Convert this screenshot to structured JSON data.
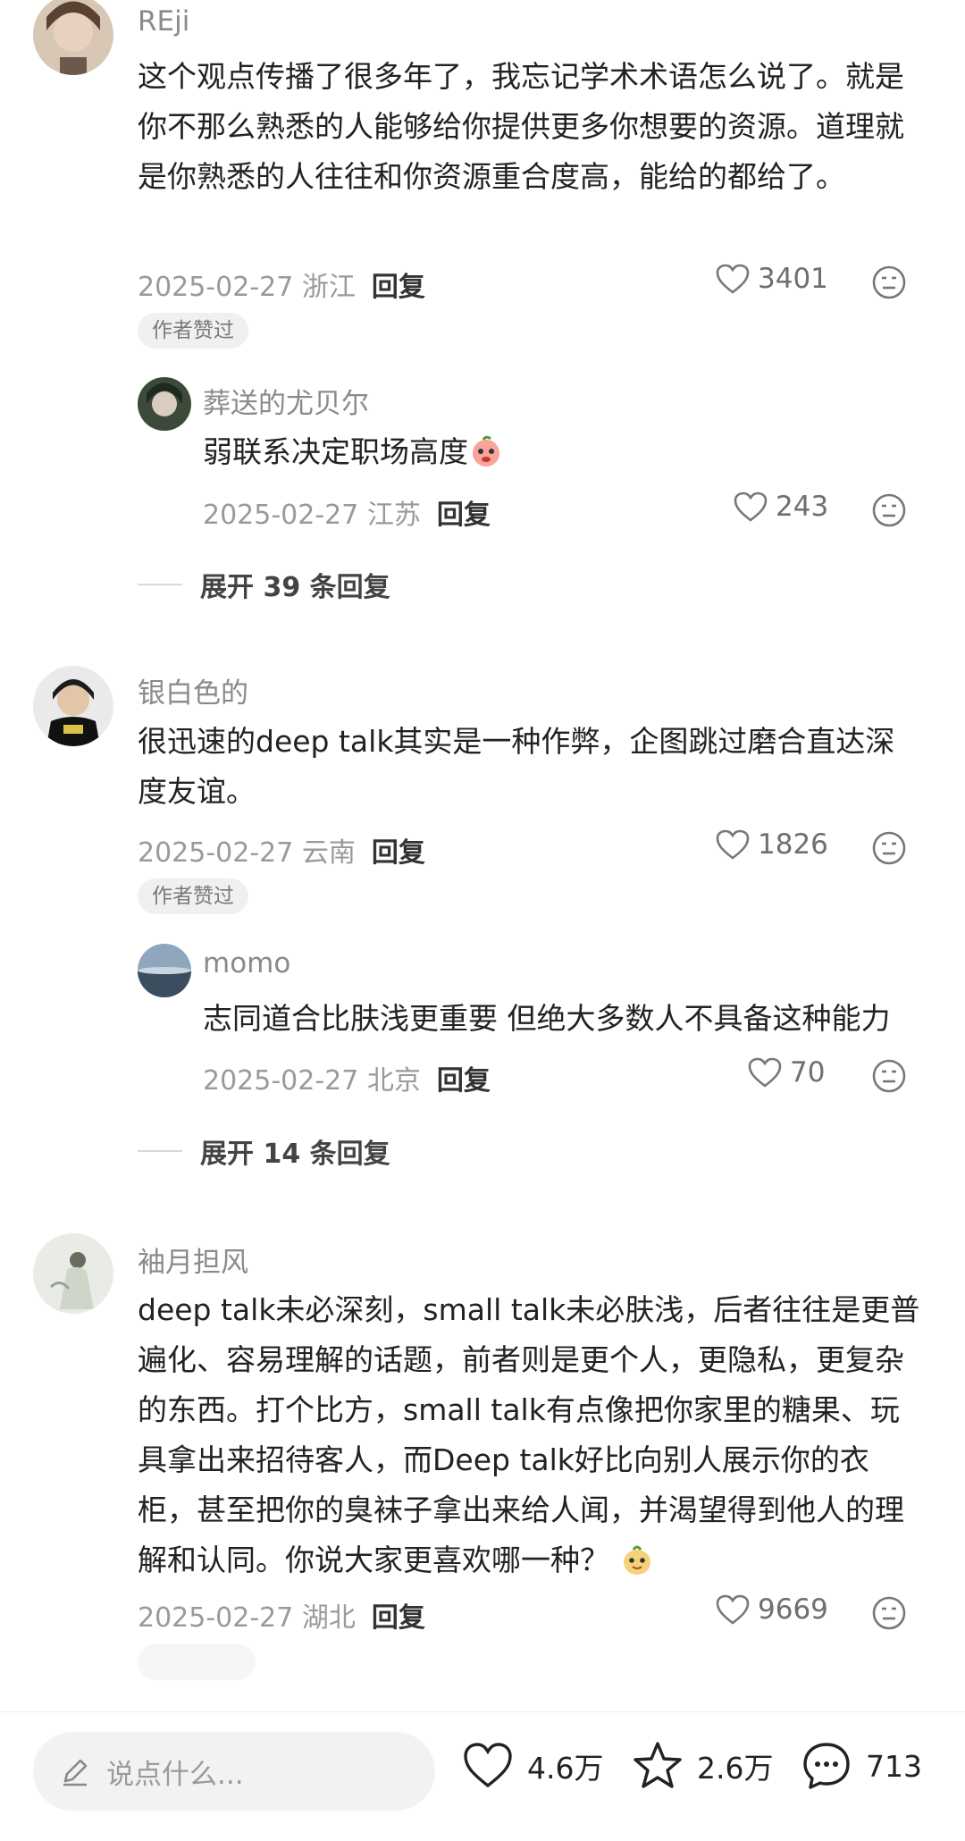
{
  "comments": [
    {
      "username": "REji",
      "text": "这个观点传播了很多年了，我忘记学术术语怎么说了。就是你不那么熟悉的人能够给你提供更多你想要的资源。道理就是你熟悉的人往往和你资源重合度高，能给的都给了。",
      "date_location": "2025-02-27 浙江",
      "reply_label": "回复",
      "likes": "3401",
      "badge": "作者赞过",
      "sub_reply": {
        "username": "葬送的尤贝尔",
        "text": "弱联系决定职场高度",
        "date_location": "2025-02-27 江苏",
        "reply_label": "回复",
        "likes": "243"
      },
      "expand_label": "展开 39 条回复"
    },
    {
      "username": "银白色的",
      "text": "很迅速的deep talk其实是一种作弊，企图跳过磨合直达深度友谊。",
      "date_location": "2025-02-27 云南",
      "reply_label": "回复",
      "likes": "1826",
      "badge": "作者赞过",
      "sub_reply": {
        "username": "momo",
        "text": "志同道合比肤浅更重要 但绝大多数人不具备这种能力",
        "date_location": "2025-02-27 北京",
        "reply_label": "回复",
        "likes": "70"
      },
      "expand_label": "展开 14 条回复"
    },
    {
      "username": "袖月担风",
      "text": "deep talk未必深刻，small talk未必肤浅，后者往往是更普遍化、容易理解的话题，前者则是更个人，更隐私，更复杂的东西。打个比方，small talk有点像把你家里的糖果、玩具拿出来招待客人，而Deep talk好比向别人展示你的衣柜，甚至把你的臭袜子拿出来给人闻，并渴望得到他人的理解和认同。你说大家更喜欢哪一种？",
      "date_location": "2025-02-27 湖北",
      "reply_label": "回复",
      "likes": "9669"
    }
  ],
  "bottom_bar": {
    "input_placeholder": "说点什么...",
    "likes": "4.6万",
    "favorites": "2.6万",
    "comments": "713"
  },
  "colors": {
    "accent_text": "#222222",
    "muted_text": "#9a9a9a",
    "badge_bg": "#f0f0f0"
  }
}
